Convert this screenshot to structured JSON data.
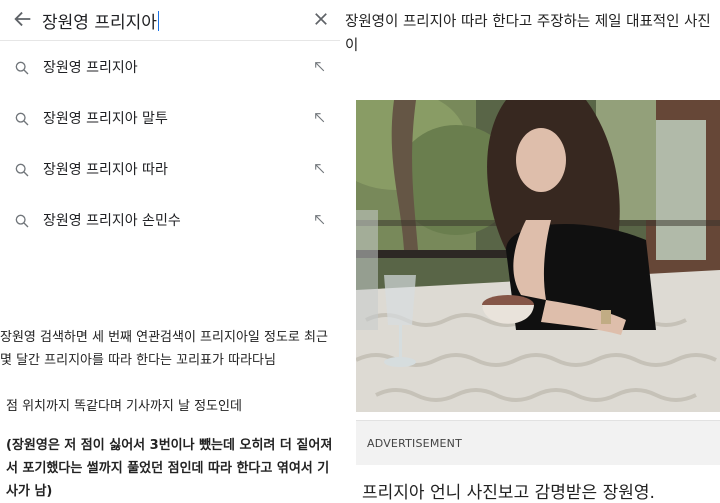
{
  "search": {
    "query": "장원영 프리지아",
    "suggestions": [
      "장원영 프리지아",
      "장원영 프리지아 말투",
      "장원영 프리지아 따라",
      "장원영 프리지아 손민수"
    ]
  },
  "article": {
    "paragraph1": "장원영 검색하면 세 번째 연관검색이 프리지아일 정도로 최근 몇 달간 프리지아를 따라 한다는 꼬리표가 따라다님",
    "paragraph2": "점 위치까지 똑같다며 기사까지 날 정도인데",
    "paragraph3": "(장원영은 저 점이 싫어서 3번이나 뺐는데 오히려 더 짙어져서 포기했다는 썰까지 풀었던 점인데 따라 한다고 엮여서 기사가 남)"
  },
  "right_panel": {
    "headline": "장원영이 프리지아 따라 한다고 주장하는 제일 대표적인 사진이",
    "ad_label": "ADVERTISEMENT",
    "caption": "프리지아 언니 사진보고 감명받은 장원영."
  },
  "icons": {
    "back": "arrow-left-icon",
    "clear": "close-icon",
    "search": "search-icon",
    "fill_query": "arrow-up-left-icon"
  },
  "colors": {
    "caret": "#1a73e8",
    "ad_band": "#f2f2f2"
  }
}
